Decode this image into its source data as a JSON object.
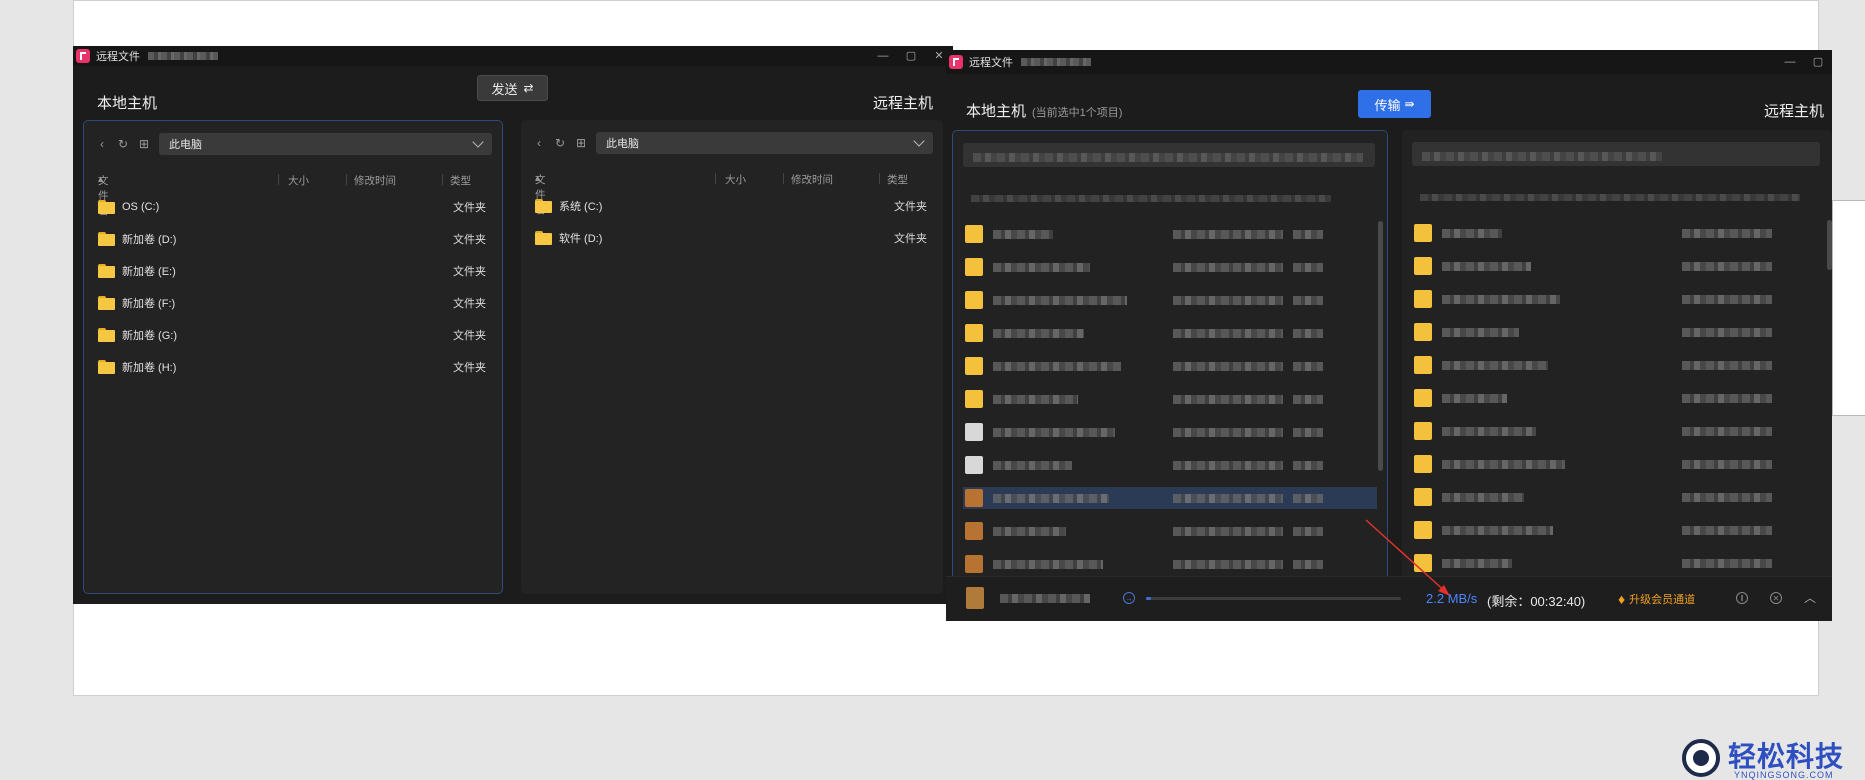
{
  "left_window": {
    "title": "远程文件",
    "window_controls": [
      "—",
      "▢",
      "✕"
    ],
    "local_host_label": "本地主机",
    "remote_host_label": "远程主机",
    "send_button": {
      "label": "发送",
      "icon": "swap-icon"
    },
    "local_pane": {
      "path": "此电脑",
      "columns": [
        "文件名",
        "大小",
        "修改时间",
        "类型"
      ],
      "rows": [
        {
          "name": "OS (C:)",
          "type": "文件夹"
        },
        {
          "name": "新加卷 (D:)",
          "type": "文件夹"
        },
        {
          "name": "新加卷 (E:)",
          "type": "文件夹"
        },
        {
          "name": "新加卷 (F:)",
          "type": "文件夹"
        },
        {
          "name": "新加卷 (G:)",
          "type": "文件夹"
        },
        {
          "name": "新加卷 (H:)",
          "type": "文件夹"
        }
      ]
    },
    "remote_pane": {
      "path": "此电脑",
      "columns": [
        "文件名",
        "大小",
        "修改时间",
        "类型"
      ],
      "rows": [
        {
          "name": "系统 (C:)",
          "type": "文件夹"
        },
        {
          "name": "软件 (D:)",
          "type": "文件夹"
        }
      ]
    }
  },
  "right_window": {
    "title": "远程文件",
    "window_controls": [
      "—",
      "▢"
    ],
    "local_host_label": "本地主机",
    "selection_note": "(当前选中1个项目)",
    "remote_host_label": "远程主机",
    "transfer_button": {
      "label": "传输",
      "icon": "transfer-arrow-icon"
    },
    "transfer_bar": {
      "speed": "2.2 MB/s",
      "remaining": "(剩余：00:32:40)",
      "upgrade_label": "升级会员通道",
      "progress": 0.02,
      "icons": [
        "zip-file-icon",
        "transfer-direction-icon",
        "crown-icon",
        "pause-icon",
        "cancel-icon",
        "chevron-up-icon"
      ]
    }
  },
  "watermark": {
    "text": "轻松科技",
    "subtext": "YNQINGSONG.COM"
  },
  "colors": {
    "accent": "#2f6fe8",
    "brand": "#e8336b",
    "folder": "#f6c743",
    "upgrade": "#f0a020",
    "annotation": "#e0312b"
  }
}
